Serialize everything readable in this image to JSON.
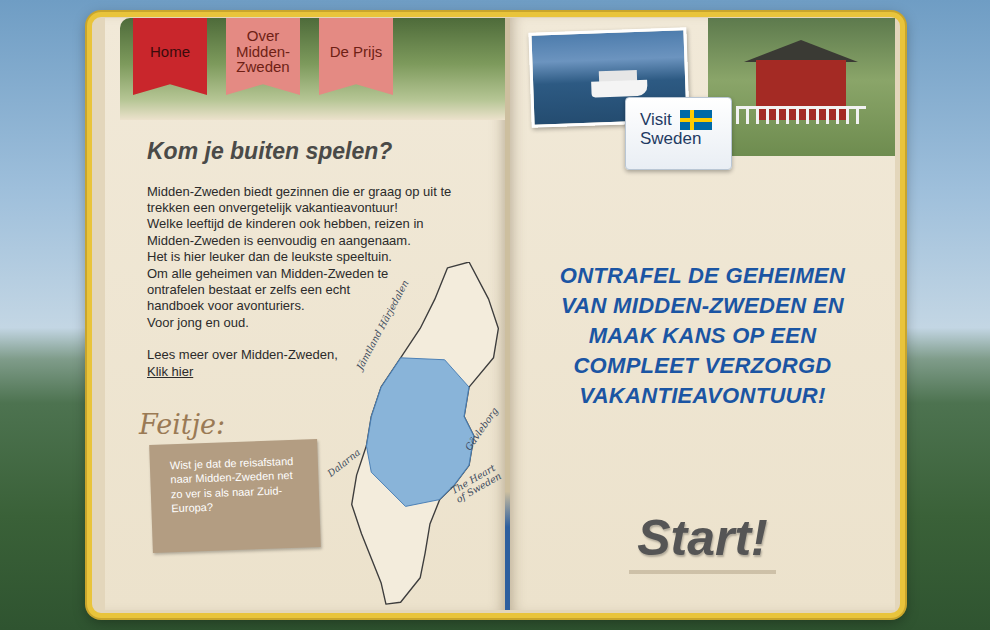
{
  "tabs": [
    {
      "label": "Home",
      "selected": true
    },
    {
      "label": "Over Midden-Zweden",
      "selected": false
    },
    {
      "label": "De Prijs",
      "selected": false
    }
  ],
  "intro": {
    "heading": "Kom je buiten spelen?",
    "lines": [
      "Midden-Zweden biedt gezinnen die er graag op uit te",
      "trekken een onvergetelijk vakantieavontuur!",
      "Welke leeftijd de kinderen ook hebben, reizen in",
      "Midden-Zweden is eenvoudig en aangenaam.",
      "Het is hier leuker dan de leukste speeltuin.",
      "Om alle geheimen van Midden-Zweden te",
      "ontrafelen bestaat er zelfs een echt",
      "handboek voor avonturiers.",
      "Voor jong en oud."
    ],
    "more": "Lees meer over Midden-Zweden,",
    "link": "Klik hier"
  },
  "map": {
    "labels": [
      "Jämtland Härjedalen",
      "Gävleborg",
      "Dalarna",
      "The Heart of Sweden"
    ]
  },
  "fact": {
    "title": "Feitje:",
    "text": "Wist je dat de reisafstand naar Midden-Zweden net zo ver is als naar Zuid-Europa?"
  },
  "logo": {
    "line1": "Visit",
    "line2": "Sweden"
  },
  "promo": {
    "lines": [
      "ONTRAFEL DE GEHEIMEN",
      "VAN MIDDEN-ZWEDEN EN",
      "MAAK KANS OP EEN",
      "COMPLEET VERZORGD",
      "VAKANTIEAVONTUUR!"
    ]
  },
  "start": "Start!"
}
